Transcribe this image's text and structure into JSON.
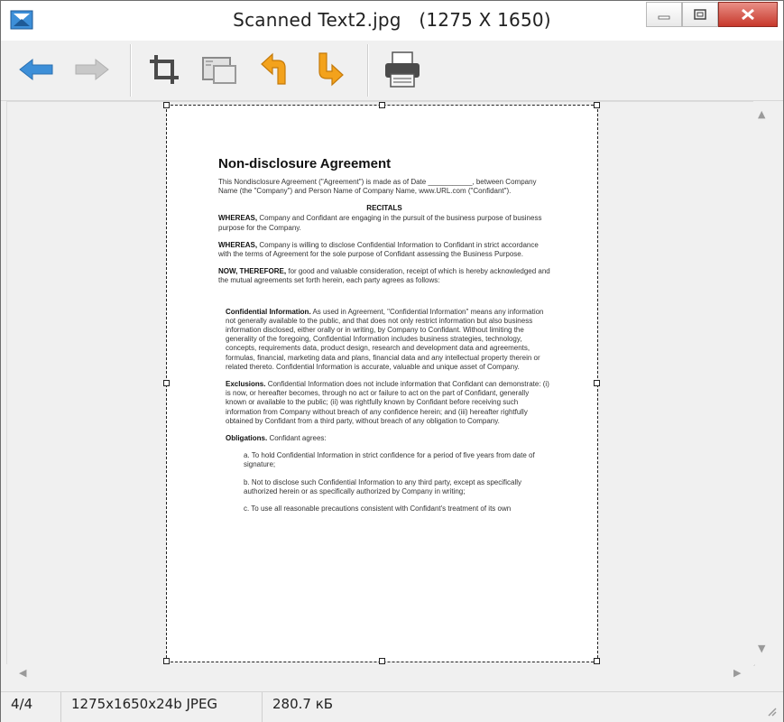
{
  "window": {
    "title": "Scanned Text2.jpg   (1275 X 1650)"
  },
  "toolbar": {
    "buttons": [
      "back-arrow",
      "forward-arrow",
      "crop",
      "resize",
      "rotate-left",
      "rotate-right",
      "print"
    ]
  },
  "document": {
    "title": "Non-disclosure Agreement",
    "intro": "This Nondisclosure Agreement (\"Agreement\") is made as of Date ___________, between Company Name (the \"Company\") and Person Name of Company Name, www.URL.com (\"Confidant\").",
    "recitals_heading": "RECITALS",
    "whereas1_lead": "WHEREAS,",
    "whereas1": " Company and Confidant are engaging in the pursuit of the business purpose of business purpose for the Company.",
    "whereas2_lead": "WHEREAS,",
    "whereas2": " Company is willing to disclose Confidential Information to Confidant in strict accordance with the terms of Agreement for the sole purpose of Confidant assessing the Business Purpose.",
    "now_lead": "NOW, THEREFORE,",
    "now": " for good and valuable consideration, receipt of which is hereby acknowledged and the mutual agreements set forth herein, each party agrees as follows:",
    "ci_lead": "Confidential Information.",
    "ci": " As used in Agreement, \"Confidential Information\" means any information not generally available to the public, and that does not only restrict information but also business information disclosed, either orally or in writing, by Company to Confidant. Without limiting the generality of the foregoing, Confidential Information includes business strategies, technology, concepts, requirements data, product design, research and development data and agreements, formulas, financial, marketing data and plans, financial data and any intellectual property therein or related thereto. Confidential Information is accurate, valuable and unique asset of Company.",
    "ex_lead": "Exclusions.",
    "ex": " Confidential Information does not include information that Confidant can demonstrate: (i) is now, or hereafter becomes, through no act or failure to act on the part of Confidant, generally known or available to the public; (ii) was rightfully known by Confidant before receiving such information from Company without breach of any confidence herein; and (iii) hereafter rightfully obtained by Confidant from a third party, without breach of any obligation to Company.",
    "ob_lead": "Obligations.",
    "ob": " Confidant agrees:",
    "ob1": "a.  To hold Confidential Information in strict confidence for a period of five years from date of signature;",
    "ob2": "b.  Not to disclose such Confidential Information to any third party, except as specifically authorized herein or as specifically authorized by Company in writing;",
    "ob3": "c.  To use all reasonable precautions consistent with Confidant's treatment of its own"
  },
  "status": {
    "index": "4/4",
    "info": "1275x1650x24b JPEG",
    "size": "280.7 кБ"
  },
  "colors": {
    "accent_orange": "#f3a21c",
    "accent_blue": "#3d8fd8",
    "close_red": "#c7382b"
  }
}
